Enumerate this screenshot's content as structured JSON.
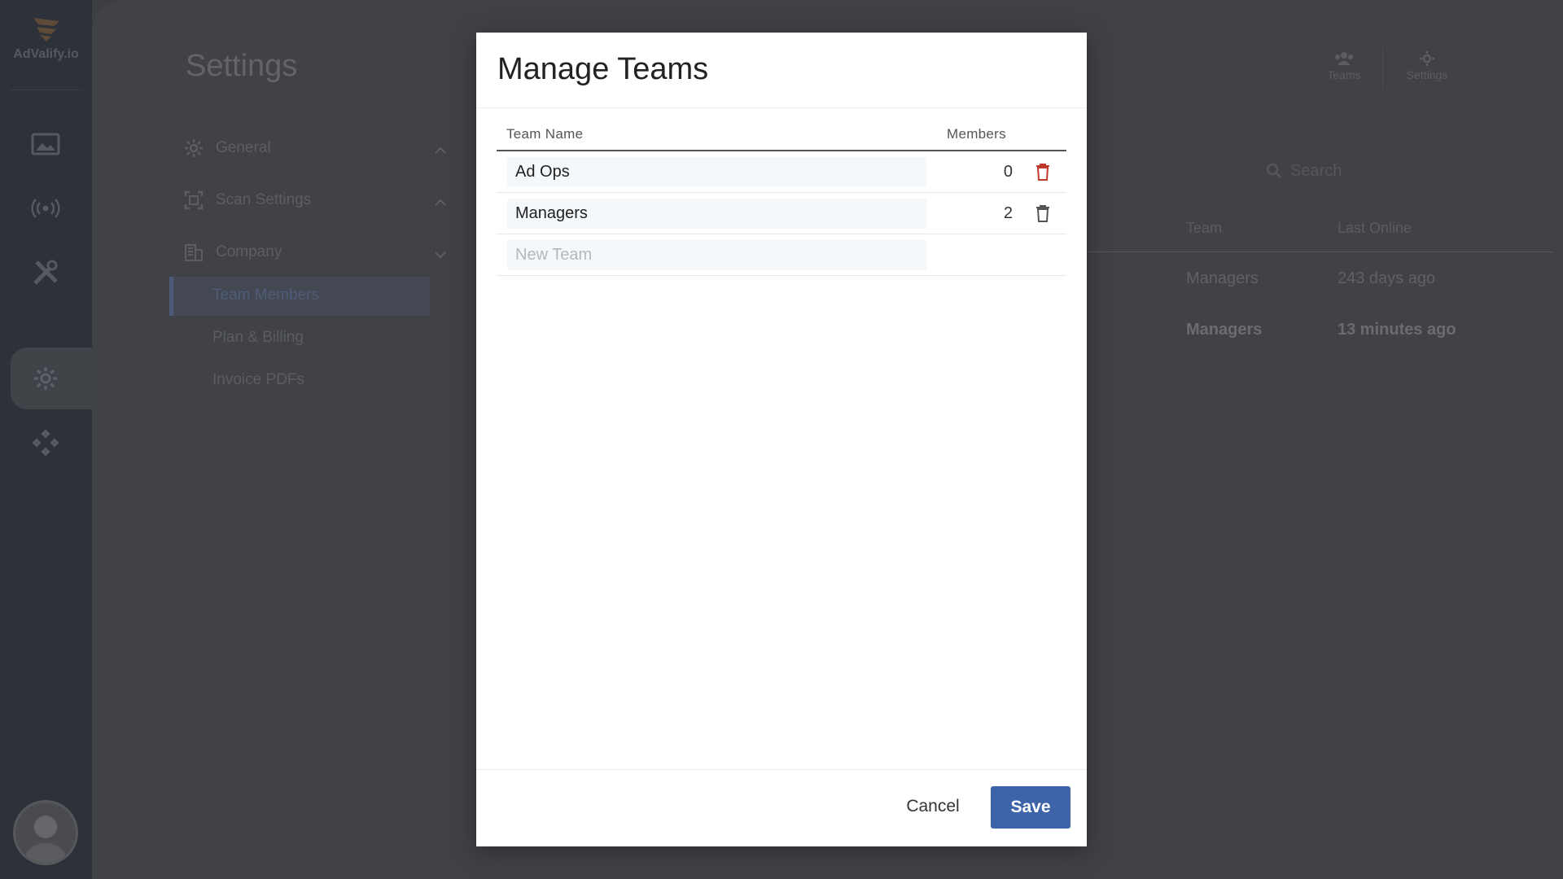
{
  "app": {
    "logo_text": "AdValify.io"
  },
  "rail": {
    "items": [
      "image-icon",
      "broadcast-icon",
      "tools-icon",
      "gear-icon",
      "integrations-icon"
    ],
    "active": "gear-icon"
  },
  "page": {
    "title": "Settings"
  },
  "top_tools": [
    {
      "label": "Teams",
      "icon": "teams-icon"
    },
    {
      "label": "Settings",
      "icon": "settings-icon"
    }
  ],
  "settings_nav": {
    "sections": [
      {
        "label": "General",
        "icon": "gear-icon",
        "expanded": false
      },
      {
        "label": "Scan Settings",
        "icon": "scan-icon",
        "expanded": false
      },
      {
        "label": "Company",
        "icon": "building-icon",
        "expanded": true
      }
    ],
    "sub_items": [
      "Team Members",
      "Plan & Billing",
      "Invoice PDFs"
    ],
    "active_sub": "Team Members"
  },
  "search": {
    "placeholder": "Search"
  },
  "bg_table": {
    "headers": [
      "Team",
      "Last Online"
    ],
    "rows": [
      {
        "team": "Managers",
        "last_online": "243 days ago"
      },
      {
        "team": "Managers",
        "last_online": "13 minutes ago"
      }
    ]
  },
  "modal": {
    "title": "Manage Teams",
    "columns": {
      "name": "Team Name",
      "members": "Members"
    },
    "teams": [
      {
        "name": "Ad Ops",
        "members": "0"
      },
      {
        "name": "Managers",
        "members": "2"
      }
    ],
    "new_team_placeholder": "New Team",
    "cancel_label": "Cancel",
    "save_label": "Save"
  },
  "colors": {
    "accent": "#3d64a8",
    "danger": "#c0392b",
    "rail_bg": "#2d3139",
    "overlay_bg": "#404247"
  }
}
